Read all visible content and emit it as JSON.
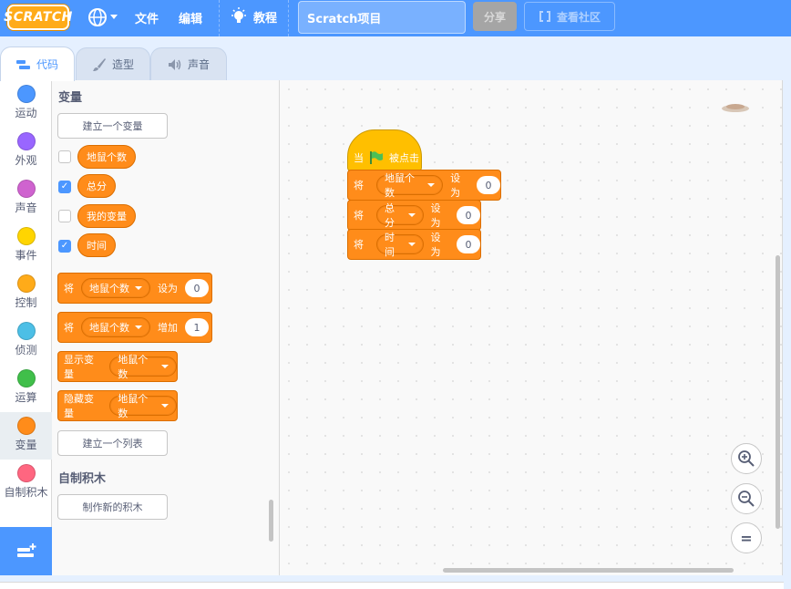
{
  "menubar": {
    "logo": "SCRATCH",
    "file": "文件",
    "edit": "编辑",
    "tutorials": "教程",
    "project_title": "Scratch项目",
    "share": "分享",
    "see_community": "查看社区"
  },
  "tabs": {
    "code": "代码",
    "costumes": "造型",
    "sounds": "声音"
  },
  "categories": [
    {
      "label": "运动",
      "color": "#4c97ff"
    },
    {
      "label": "外观",
      "color": "#9966ff"
    },
    {
      "label": "声音",
      "color": "#cf63cf"
    },
    {
      "label": "事件",
      "color": "#ffd500"
    },
    {
      "label": "控制",
      "color": "#ffab19"
    },
    {
      "label": "侦测",
      "color": "#4cbfe6"
    },
    {
      "label": "运算",
      "color": "#40bf4a"
    },
    {
      "label": "变量",
      "color": "#ff8c1a"
    },
    {
      "label": "自制积木",
      "color": "#ff6680"
    }
  ],
  "palette": {
    "variables_title": "变量",
    "make_variable": "建立一个变量",
    "variables": [
      {
        "name": "地鼠个数",
        "checked": false
      },
      {
        "name": "总分",
        "checked": true
      },
      {
        "name": "我的变量",
        "checked": false
      },
      {
        "name": "时间",
        "checked": true
      }
    ],
    "set_block": {
      "prefix": "将",
      "var": "地鼠个数",
      "action": "设为",
      "value": "0"
    },
    "change_block": {
      "prefix": "将",
      "var": "地鼠个数",
      "action": "增加",
      "value": "1"
    },
    "show_block": {
      "label": "显示变量",
      "var": "地鼠个数"
    },
    "hide_block": {
      "label": "隐藏变量",
      "var": "地鼠个数"
    },
    "make_list": "建立一个列表",
    "my_blocks_title": "自制积木",
    "make_block": "制作新的积木"
  },
  "script": {
    "hat_when": "当",
    "hat_clicked": "被点击",
    "blocks": [
      {
        "prefix": "将",
        "var": "地鼠个数",
        "action": "设为",
        "value": "0"
      },
      {
        "prefix": "将",
        "var": "总分",
        "action": "设为",
        "value": "0"
      },
      {
        "prefix": "将",
        "var": "时间",
        "action": "设为",
        "value": "0"
      }
    ]
  },
  "zoom": {
    "reset": "="
  }
}
